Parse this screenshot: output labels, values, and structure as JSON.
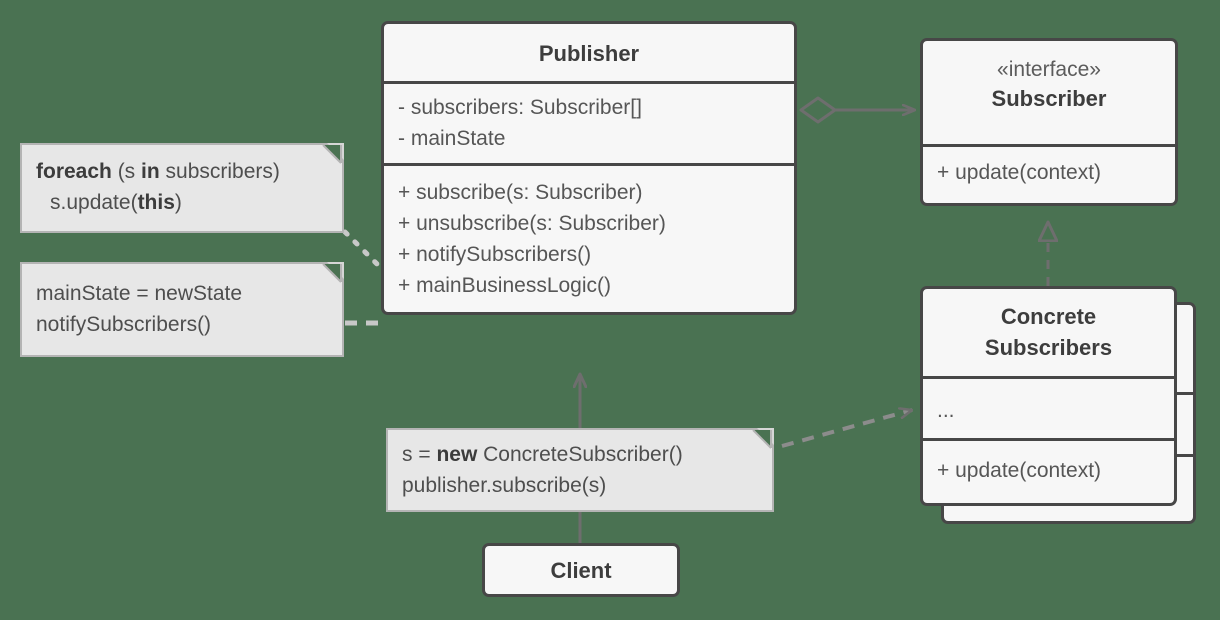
{
  "diagram": {
    "title": "Observer design pattern UML class diagram",
    "background_color": "#4a7252",
    "box_fill": "#f7f7f7",
    "box_border": "#474747",
    "note_fill": "#e7e7e7",
    "note_border": "#b4b4b4",
    "connector_color": "#6e6e6e",
    "note_link_color": "#c8c8c8"
  },
  "classes": {
    "publisher": {
      "name": "Publisher",
      "fields": [
        "- subscribers: Subscriber[]",
        "- mainState"
      ],
      "methods": [
        "+ subscribe(s: Subscriber)",
        "+ unsubscribe(s: Subscriber)",
        "+ notifySubscribers()",
        "+ mainBusinessLogic()"
      ]
    },
    "subscriber": {
      "stereotype": "«interface»",
      "name": "Subscriber",
      "methods": [
        "+ update(context)"
      ]
    },
    "concrete_subscribers": {
      "name_line1": "Concrete",
      "name_line2": "Subscribers",
      "fields": [
        "..."
      ],
      "methods": [
        "+ update(context)"
      ]
    },
    "client": {
      "name": "Client"
    }
  },
  "notes": {
    "foreach": {
      "line1_bold_1": "foreach",
      "line1_plain_1": " (s ",
      "line1_bold_2": "in",
      "line1_plain_2": " subscribers)",
      "line2_plain_1": "s.update(",
      "line2_bold_1": "this",
      "line2_plain_2": ")"
    },
    "main_state": {
      "line1": "mainState = newState",
      "line2": "notifySubscribers()"
    },
    "client_code": {
      "line1_plain_1": "s = ",
      "line1_bold_1": "new",
      "line1_plain_2": " ConcreteSubscriber()",
      "line2": "publisher.subscribe(s)"
    }
  },
  "relations": [
    {
      "name": "publisher-aggregates-subscriber",
      "from": "Publisher",
      "to": "Subscriber",
      "type": "aggregation",
      "source_marker": "open-diamond",
      "target_marker": "open-arrow",
      "line": "solid"
    },
    {
      "name": "concrete-implements-subscriber",
      "from": "Concrete Subscribers",
      "to": "Subscriber",
      "type": "realization",
      "source_marker": "none",
      "target_marker": "hollow-triangle",
      "line": "dashed"
    },
    {
      "name": "client-uses-publisher",
      "from": "Client",
      "to": "Publisher",
      "type": "association",
      "source_marker": "none",
      "target_marker": "open-arrow",
      "line": "solid"
    },
    {
      "name": "client-note-to-concrete",
      "from": "client code note",
      "to": "Concrete Subscribers",
      "type": "dependency",
      "source_marker": "none",
      "target_marker": "open-arrow",
      "line": "dashed"
    },
    {
      "name": "foreach-note-anchor",
      "from": "foreach note",
      "to": "Publisher notifySubscribers()",
      "type": "note-link",
      "line": "dotted"
    },
    {
      "name": "main-state-note-anchor",
      "from": "mainState note",
      "to": "Publisher mainBusinessLogic()",
      "type": "note-link",
      "line": "dashed"
    }
  ]
}
